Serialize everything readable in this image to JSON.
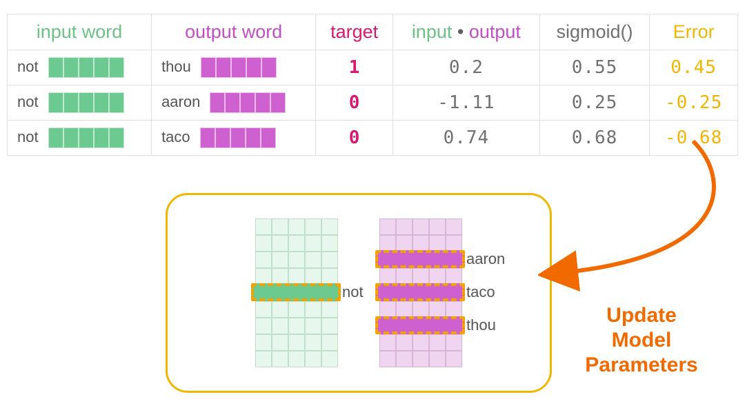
{
  "table": {
    "headers": {
      "input_word": "input word",
      "output_word": "output word",
      "target": "target",
      "dot_input": "input",
      "dot_symbol": "•",
      "dot_output": "output",
      "sigmoid": "sigmoid()",
      "error": "Error"
    },
    "rows": [
      {
        "input": "not",
        "output": "thou",
        "target": "1",
        "dot": "0.2",
        "sigmoid": "0.55",
        "error": "0.45"
      },
      {
        "input": "not",
        "output": "aaron",
        "target": "0",
        "dot": "-1.11",
        "sigmoid": "0.25",
        "error": "-0.25"
      },
      {
        "input": "not",
        "output": "taco",
        "target": "0",
        "dot": "0.74",
        "sigmoid": "0.68",
        "error": "-0.68"
      }
    ]
  },
  "panel": {
    "input_label": "not",
    "output_labels": [
      "aaron",
      "taco",
      "thou"
    ]
  },
  "caption": {
    "line1": "Update",
    "line2": "Model",
    "line3": "Parameters"
  },
  "colors": {
    "green": "#6cc285",
    "magenta": "#c34ec3",
    "target": "#d9186f",
    "gray": "#707070",
    "yellow": "#f2b600",
    "orange": "#f06a00"
  }
}
